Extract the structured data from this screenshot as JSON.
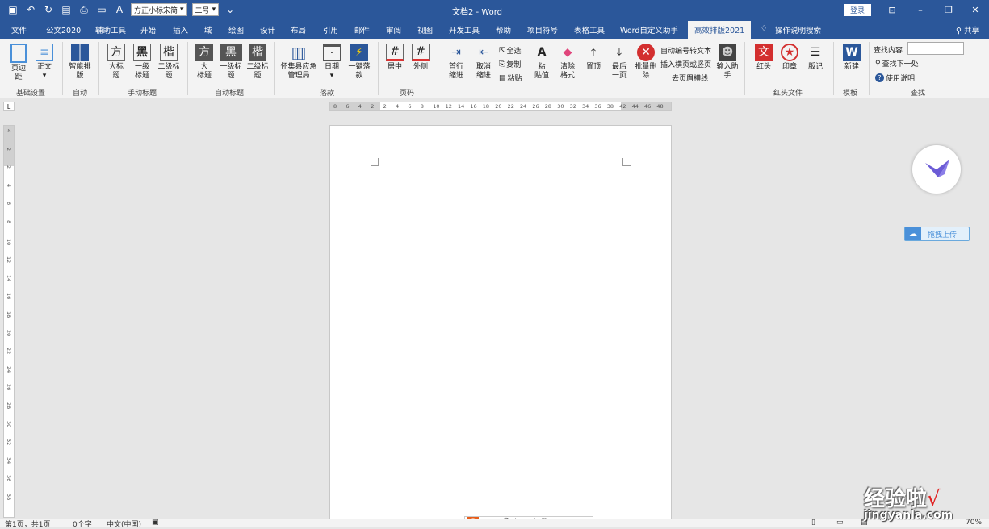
{
  "titlebar": {
    "font_name": "方正小标宋简",
    "font_size": "二号",
    "doc_title": "文档2 - Word",
    "login": "登录"
  },
  "tabs": [
    "文件",
    "公文2020",
    "辅助工具",
    "开始",
    "插入",
    "域",
    "绘图",
    "设计",
    "布局",
    "引用",
    "邮件",
    "审阅",
    "视图",
    "开发工具",
    "帮助",
    "项目符号",
    "表格工具",
    "Word自定义助手",
    "高效排版2021"
  ],
  "tell_me": "操作说明搜索",
  "share": "共享",
  "ribbon": {
    "basic": {
      "margin": "页边\n距",
      "body": "正文",
      "label": "基础设置"
    },
    "auto": {
      "smart": "智能排\n版",
      "label": "自动"
    },
    "manual": {
      "big": "大标\n题",
      "l1": "一级\n标题",
      "l2": "二级标\n题",
      "label": "手动标题",
      "g1": "方",
      "g2": "黑",
      "g3": "楷"
    },
    "autotitle": {
      "big": "大\n标题",
      "l1": "一级标\n题",
      "l2": "二级标\n题",
      "label": "自动标题"
    },
    "sign": {
      "org": "怀集县应急\n管理局",
      "date": "日期",
      "onekey": "一键落\n款",
      "label": "落款"
    },
    "pagenum": {
      "center": "居中",
      "outer": "外侧",
      "label": "页码"
    },
    "edit": {
      "indent": "首行\n缩进",
      "unindent": "取消\n缩进",
      "select_all": "全选",
      "copy": "复制",
      "paste": "粘贴",
      "paste_value": "粘\n贴值",
      "clear_fmt": "清除\n格式",
      "top": "置顶",
      "last": "最后\n一页",
      "batch_del": "批量删\n除",
      "auto_num": "自动编号转文本",
      "insert_sep": "插入横页或竖页",
      "remove_hdr": "去页眉横线",
      "input_helper": "输入助\n手"
    },
    "redhead": {
      "head": "红头",
      "seal": "印章",
      "note": "版记",
      "label": "红头文件",
      "wen": "文"
    },
    "template": {
      "new": "新建",
      "label": "模板"
    },
    "find": {
      "find_content": "查找内容",
      "find_next": "查找下一处",
      "help": "使用说明",
      "label": "查找"
    }
  },
  "ruler_h": [
    "8",
    "6",
    "4",
    "2",
    "2",
    "4",
    "6",
    "8",
    "10",
    "12",
    "14",
    "16",
    "18",
    "20",
    "22",
    "24",
    "26",
    "28",
    "30",
    "32",
    "34",
    "36",
    "38",
    "42",
    "44",
    "46",
    "48"
  ],
  "ruler_v": [
    "4",
    "2",
    "2",
    "4",
    "6",
    "8",
    "10",
    "12",
    "14",
    "16",
    "18",
    "20",
    "22",
    "24",
    "26",
    "28",
    "30",
    "32",
    "34",
    "36",
    "38"
  ],
  "ruler_corner": "L",
  "upload_label": "拖拽上传",
  "ime": {
    "logo": "S",
    "mode": "中"
  },
  "status": {
    "page": "第1页，共1页",
    "words": "0个字",
    "lang": "中文(中国)",
    "zoom": "70%"
  },
  "watermark": {
    "text": "经验啦",
    "url": "jingyanla.com"
  },
  "colors": {
    "accent": "#2b579a",
    "red": "#e02020"
  }
}
